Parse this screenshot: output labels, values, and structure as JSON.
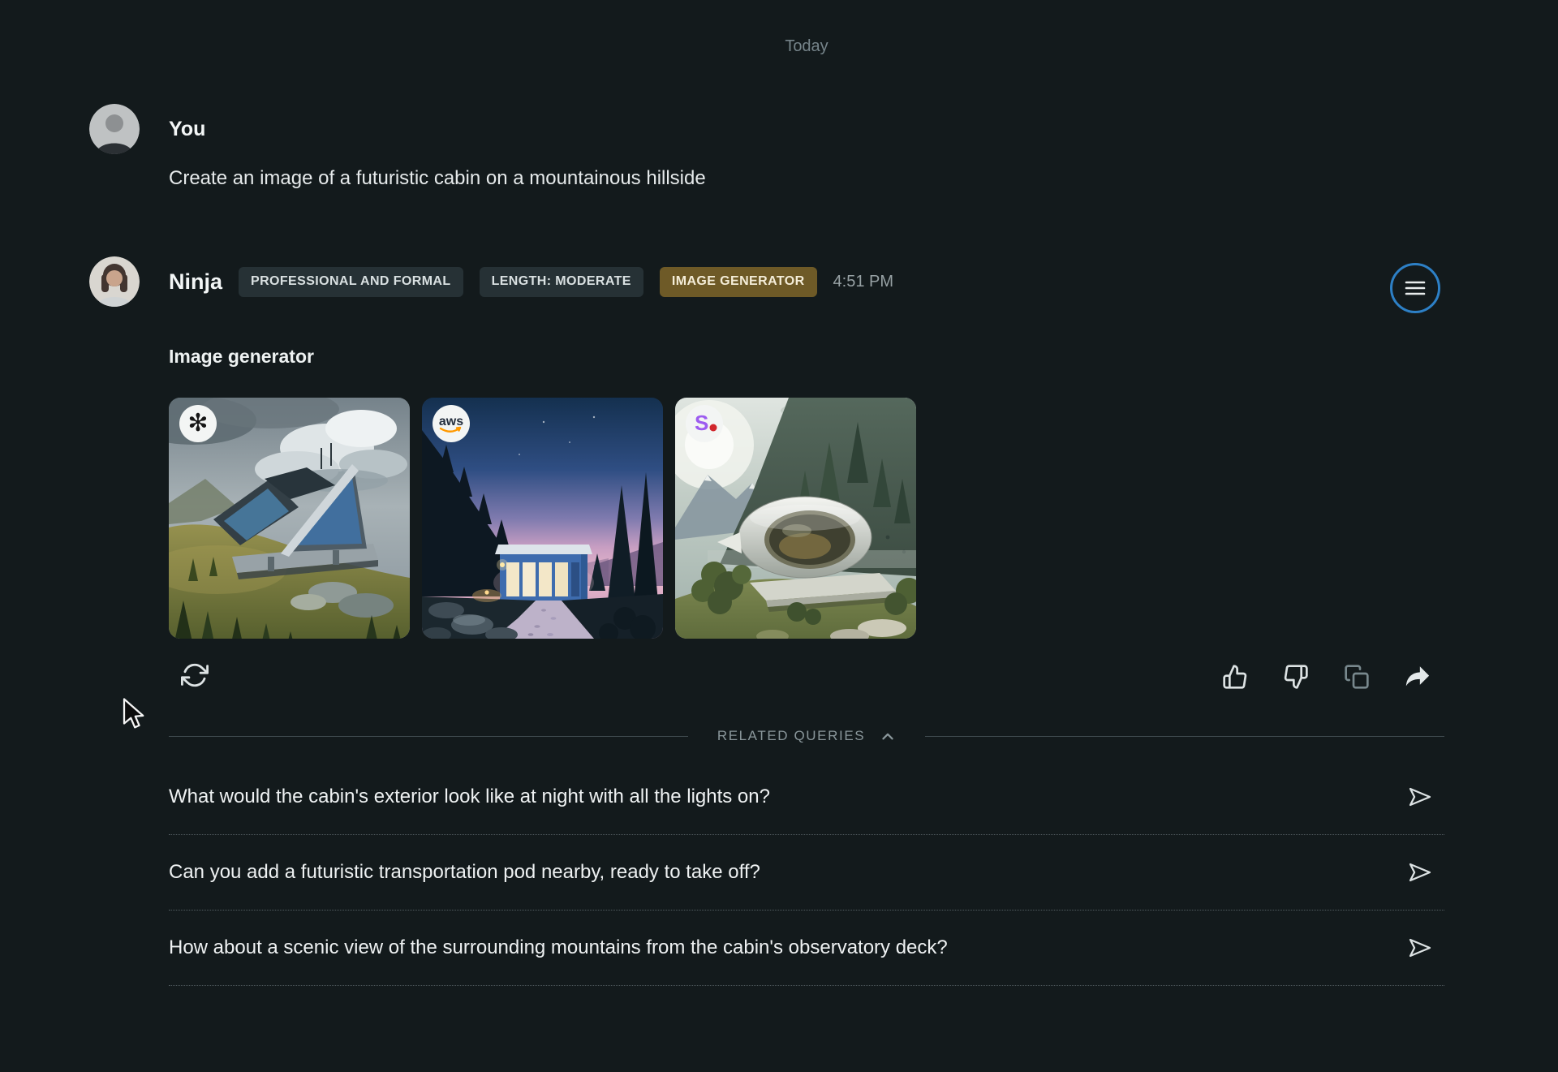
{
  "chat": {
    "date_divider": "Today",
    "user": {
      "name": "You",
      "message": "Create an image of a futuristic cabin on a mountainous hillside"
    },
    "assistant": {
      "name": "Ninja",
      "badges": [
        {
          "label": "PROFESSIONAL AND FORMAL",
          "style": "default"
        },
        {
          "label": "LENGTH: MODERATE",
          "style": "default"
        },
        {
          "label": "IMAGE GENERATOR",
          "style": "gold"
        }
      ],
      "timestamp": "4:51 PM",
      "tool_title": "Image generator",
      "images": [
        {
          "provider": "OpenAI",
          "icon": "openai-logo-icon",
          "label": "",
          "description": "Futuristic angular cabin with blue glass panels on a grassy hillside, pine trees, stormy clouds"
        },
        {
          "provider": "AWS",
          "icon": "aws-logo-icon",
          "label": "aws",
          "description": "Blue modular cabin at dusk with lit windows, gravel path, tall pines, pink-blue sky"
        },
        {
          "provider": "Stability",
          "icon": "stability-logo-icon",
          "label": "S.",
          "description": "Silver pod-shaped cabin with oval window on a cliff edge over mountain valley"
        }
      ]
    },
    "related": {
      "title": "RELATED QUERIES",
      "items": [
        {
          "text": "What would the cabin's exterior look like at night with all the lights on?"
        },
        {
          "text": "Can you add a futuristic transportation pod nearby, ready to take off?"
        },
        {
          "text": "How about a scenic view of the surrounding mountains from the cabin's observatory deck?"
        }
      ]
    }
  },
  "icons": {
    "menu": "hamburger-menu",
    "regenerate": "refresh-cycle-arrows",
    "thumbs_up": "thumbs-up-outline",
    "thumbs_down": "thumbs-down-outline",
    "copy": "copy-pages-outline",
    "share": "share-arrow-filled",
    "send": "paper-plane-outline",
    "collapse": "chevron-up",
    "openai_glyph": "✻"
  },
  "colors": {
    "background": "#131a1c",
    "accent_ring": "#2d80c6",
    "badge_bg": "#263135",
    "gold_badge_bg": "#6e5a27",
    "gold_badge_text": "#f4edd8",
    "muted_text": "#8a979b",
    "divider_line": "#3e494d"
  }
}
